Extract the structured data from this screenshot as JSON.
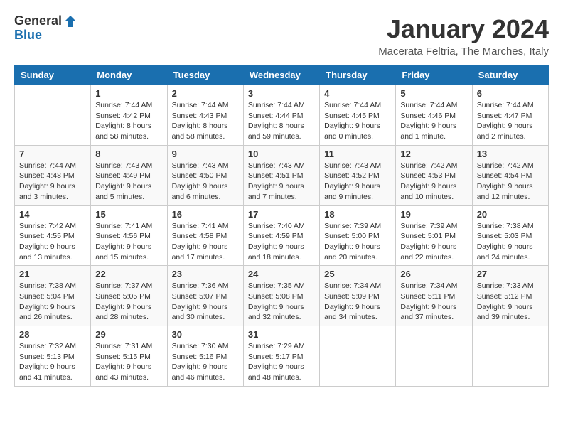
{
  "logo": {
    "general": "General",
    "blue": "Blue"
  },
  "title": {
    "month": "January 2024",
    "location": "Macerata Feltria, The Marches, Italy"
  },
  "calendar": {
    "headers": [
      "Sunday",
      "Monday",
      "Tuesday",
      "Wednesday",
      "Thursday",
      "Friday",
      "Saturday"
    ],
    "weeks": [
      [
        {
          "day": "",
          "sunrise": "",
          "sunset": "",
          "daylight": ""
        },
        {
          "day": "1",
          "sunrise": "Sunrise: 7:44 AM",
          "sunset": "Sunset: 4:42 PM",
          "daylight": "Daylight: 8 hours and 58 minutes."
        },
        {
          "day": "2",
          "sunrise": "Sunrise: 7:44 AM",
          "sunset": "Sunset: 4:43 PM",
          "daylight": "Daylight: 8 hours and 58 minutes."
        },
        {
          "day": "3",
          "sunrise": "Sunrise: 7:44 AM",
          "sunset": "Sunset: 4:44 PM",
          "daylight": "Daylight: 8 hours and 59 minutes."
        },
        {
          "day": "4",
          "sunrise": "Sunrise: 7:44 AM",
          "sunset": "Sunset: 4:45 PM",
          "daylight": "Daylight: 9 hours and 0 minutes."
        },
        {
          "day": "5",
          "sunrise": "Sunrise: 7:44 AM",
          "sunset": "Sunset: 4:46 PM",
          "daylight": "Daylight: 9 hours and 1 minute."
        },
        {
          "day": "6",
          "sunrise": "Sunrise: 7:44 AM",
          "sunset": "Sunset: 4:47 PM",
          "daylight": "Daylight: 9 hours and 2 minutes."
        }
      ],
      [
        {
          "day": "7",
          "sunrise": "Sunrise: 7:44 AM",
          "sunset": "Sunset: 4:48 PM",
          "daylight": "Daylight: 9 hours and 3 minutes."
        },
        {
          "day": "8",
          "sunrise": "Sunrise: 7:43 AM",
          "sunset": "Sunset: 4:49 PM",
          "daylight": "Daylight: 9 hours and 5 minutes."
        },
        {
          "day": "9",
          "sunrise": "Sunrise: 7:43 AM",
          "sunset": "Sunset: 4:50 PM",
          "daylight": "Daylight: 9 hours and 6 minutes."
        },
        {
          "day": "10",
          "sunrise": "Sunrise: 7:43 AM",
          "sunset": "Sunset: 4:51 PM",
          "daylight": "Daylight: 9 hours and 7 minutes."
        },
        {
          "day": "11",
          "sunrise": "Sunrise: 7:43 AM",
          "sunset": "Sunset: 4:52 PM",
          "daylight": "Daylight: 9 hours and 9 minutes."
        },
        {
          "day": "12",
          "sunrise": "Sunrise: 7:42 AM",
          "sunset": "Sunset: 4:53 PM",
          "daylight": "Daylight: 9 hours and 10 minutes."
        },
        {
          "day": "13",
          "sunrise": "Sunrise: 7:42 AM",
          "sunset": "Sunset: 4:54 PM",
          "daylight": "Daylight: 9 hours and 12 minutes."
        }
      ],
      [
        {
          "day": "14",
          "sunrise": "Sunrise: 7:42 AM",
          "sunset": "Sunset: 4:55 PM",
          "daylight": "Daylight: 9 hours and 13 minutes."
        },
        {
          "day": "15",
          "sunrise": "Sunrise: 7:41 AM",
          "sunset": "Sunset: 4:56 PM",
          "daylight": "Daylight: 9 hours and 15 minutes."
        },
        {
          "day": "16",
          "sunrise": "Sunrise: 7:41 AM",
          "sunset": "Sunset: 4:58 PM",
          "daylight": "Daylight: 9 hours and 17 minutes."
        },
        {
          "day": "17",
          "sunrise": "Sunrise: 7:40 AM",
          "sunset": "Sunset: 4:59 PM",
          "daylight": "Daylight: 9 hours and 18 minutes."
        },
        {
          "day": "18",
          "sunrise": "Sunrise: 7:39 AM",
          "sunset": "Sunset: 5:00 PM",
          "daylight": "Daylight: 9 hours and 20 minutes."
        },
        {
          "day": "19",
          "sunrise": "Sunrise: 7:39 AM",
          "sunset": "Sunset: 5:01 PM",
          "daylight": "Daylight: 9 hours and 22 minutes."
        },
        {
          "day": "20",
          "sunrise": "Sunrise: 7:38 AM",
          "sunset": "Sunset: 5:03 PM",
          "daylight": "Daylight: 9 hours and 24 minutes."
        }
      ],
      [
        {
          "day": "21",
          "sunrise": "Sunrise: 7:38 AM",
          "sunset": "Sunset: 5:04 PM",
          "daylight": "Daylight: 9 hours and 26 minutes."
        },
        {
          "day": "22",
          "sunrise": "Sunrise: 7:37 AM",
          "sunset": "Sunset: 5:05 PM",
          "daylight": "Daylight: 9 hours and 28 minutes."
        },
        {
          "day": "23",
          "sunrise": "Sunrise: 7:36 AM",
          "sunset": "Sunset: 5:07 PM",
          "daylight": "Daylight: 9 hours and 30 minutes."
        },
        {
          "day": "24",
          "sunrise": "Sunrise: 7:35 AM",
          "sunset": "Sunset: 5:08 PM",
          "daylight": "Daylight: 9 hours and 32 minutes."
        },
        {
          "day": "25",
          "sunrise": "Sunrise: 7:34 AM",
          "sunset": "Sunset: 5:09 PM",
          "daylight": "Daylight: 9 hours and 34 minutes."
        },
        {
          "day": "26",
          "sunrise": "Sunrise: 7:34 AM",
          "sunset": "Sunset: 5:11 PM",
          "daylight": "Daylight: 9 hours and 37 minutes."
        },
        {
          "day": "27",
          "sunrise": "Sunrise: 7:33 AM",
          "sunset": "Sunset: 5:12 PM",
          "daylight": "Daylight: 9 hours and 39 minutes."
        }
      ],
      [
        {
          "day": "28",
          "sunrise": "Sunrise: 7:32 AM",
          "sunset": "Sunset: 5:13 PM",
          "daylight": "Daylight: 9 hours and 41 minutes."
        },
        {
          "day": "29",
          "sunrise": "Sunrise: 7:31 AM",
          "sunset": "Sunset: 5:15 PM",
          "daylight": "Daylight: 9 hours and 43 minutes."
        },
        {
          "day": "30",
          "sunrise": "Sunrise: 7:30 AM",
          "sunset": "Sunset: 5:16 PM",
          "daylight": "Daylight: 9 hours and 46 minutes."
        },
        {
          "day": "31",
          "sunrise": "Sunrise: 7:29 AM",
          "sunset": "Sunset: 5:17 PM",
          "daylight": "Daylight: 9 hours and 48 minutes."
        },
        {
          "day": "",
          "sunrise": "",
          "sunset": "",
          "daylight": ""
        },
        {
          "day": "",
          "sunrise": "",
          "sunset": "",
          "daylight": ""
        },
        {
          "day": "",
          "sunrise": "",
          "sunset": "",
          "daylight": ""
        }
      ]
    ]
  }
}
